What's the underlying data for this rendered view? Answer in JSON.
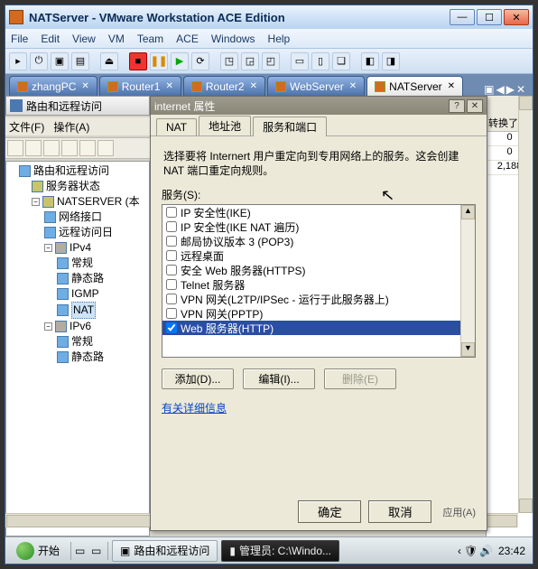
{
  "window": {
    "title": "NATServer - VMware Workstation ACE Edition",
    "menu": [
      "File",
      "Edit",
      "View",
      "VM",
      "Team",
      "ACE",
      "Windows",
      "Help"
    ]
  },
  "tabs": {
    "items": [
      {
        "label": "zhangPC"
      },
      {
        "label": "Router1"
      },
      {
        "label": "Router2"
      },
      {
        "label": "WebServer"
      },
      {
        "label": "NATServer"
      }
    ],
    "active_index": 4
  },
  "mmc": {
    "title": "路由和远程访问",
    "menu_file": "文件(F)",
    "menu_action": "操作(A)",
    "tree": {
      "root": "路由和远程访问",
      "server_status": "服务器状态",
      "server_node": "NATSERVER (本",
      "net_if": "网络接口",
      "remote_log": "远程访问日",
      "ipv4": "IPv4",
      "ipv4_children": [
        "常规",
        "静态路",
        "IGMP",
        "NAT"
      ],
      "ipv6": "IPv6",
      "ipv6_children": [
        "常规",
        "静态路"
      ]
    },
    "right_panel": {
      "header": "转换了",
      "rows": [
        "0",
        "0",
        "2,188"
      ]
    }
  },
  "dialog": {
    "title": "internet 属性",
    "tabs": [
      "NAT",
      "地址池",
      "服务和端口"
    ],
    "active_tab": 2,
    "description": "选择要将 Internert 用户重定向到专用网络上的服务。这会创建 NAT 端口重定向规则。",
    "services_label": "服务(S):",
    "services": [
      "IP 安全性(IKE)",
      "IP 安全性(IKE NAT 遍历)",
      "邮局协议版本 3 (POP3)",
      "远程桌面",
      "安全 Web 服务器(HTTPS)",
      "Telnet 服务器",
      "VPN 网关(L2TP/IPSec - 运行于此服务器上)",
      "VPN 网关(PPTP)",
      "Web 服务器(HTTP)"
    ],
    "selected_index": 8,
    "checked_index": 8,
    "btn_add": "添加(D)...",
    "btn_edit": "编辑(I)...",
    "btn_delete": "删除(E)",
    "link_more": "有关详细信息",
    "btn_ok": "确定",
    "btn_cancel": "取消",
    "btn_apply": "应用(A)"
  },
  "taskbar": {
    "start": "开始",
    "tasks": [
      {
        "label": "路由和远程访问",
        "kind": "normal"
      },
      {
        "label": "管理员: C:\\Windo...",
        "kind": "cmd"
      }
    ],
    "clock": "23:42"
  }
}
